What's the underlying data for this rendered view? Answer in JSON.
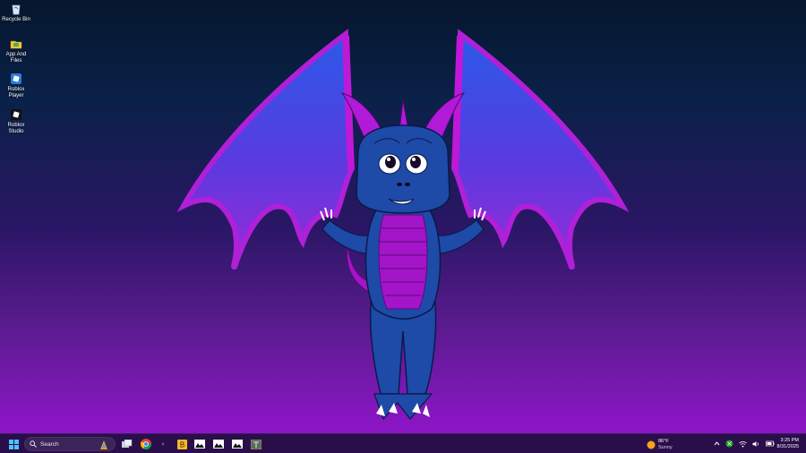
{
  "desktop": {
    "icons": [
      {
        "label": "Recycle Bin",
        "icon": "recycle-bin-icon"
      },
      {
        "label": "App And Files",
        "icon": "folder-icon"
      },
      {
        "label": "Roblox Player",
        "icon": "roblox-player-icon"
      },
      {
        "label": "Roblox Studio",
        "icon": "roblox-studio-icon"
      }
    ],
    "wallpaper": "blue-purple-dragon-with-wings"
  },
  "taskbar": {
    "start_icon": "windows-start-icon",
    "search": {
      "placeholder": "Search",
      "icon": "search-icon"
    },
    "pinned": [
      "task-view-icon",
      "chrome-icon",
      "app-icon",
      "file-explorer-icon",
      "image-icon",
      "image-icon",
      "image-icon",
      "app-icon"
    ],
    "weather": {
      "temp": "86°F",
      "condition": "Sunny",
      "icon": "sun-icon"
    },
    "tray": [
      "chevron-up-icon",
      "xbox-icon",
      "wifi-icon",
      "volume-icon",
      "battery-icon"
    ],
    "clock": {
      "time": "3:25 PM",
      "date": "8/31/2025"
    }
  },
  "colors": {
    "taskbar": "#2a0e49",
    "accent": "#0a78d4"
  }
}
